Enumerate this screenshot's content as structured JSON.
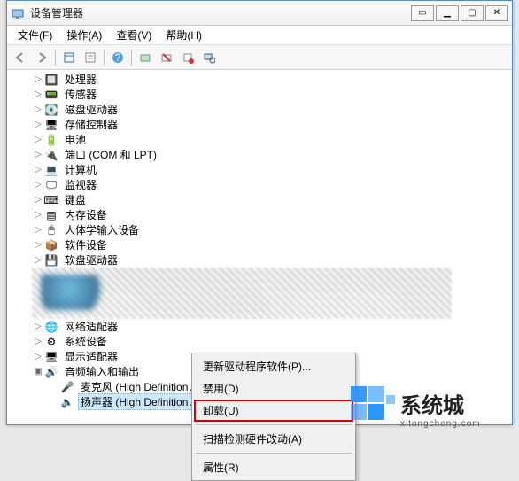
{
  "window": {
    "title": "设备管理器",
    "buttons": {
      "min": "▁",
      "max": "▢",
      "close": "✕",
      "extra": "▭"
    }
  },
  "menubar": {
    "file": "文件(F)",
    "action": "操作(A)",
    "view": "查看(V)",
    "help": "帮助(H)"
  },
  "tree": {
    "items": [
      {
        "label": "处理器",
        "icon": "cpu"
      },
      {
        "label": "传感器",
        "icon": "sensor"
      },
      {
        "label": "磁盘驱动器",
        "icon": "disk"
      },
      {
        "label": "存储控制器",
        "icon": "storage"
      },
      {
        "label": "电池",
        "icon": "battery"
      },
      {
        "label": "端口 (COM 和 LPT)",
        "icon": "port"
      },
      {
        "label": "计算机",
        "icon": "computer"
      },
      {
        "label": "监视器",
        "icon": "monitor"
      },
      {
        "label": "键盘",
        "icon": "keyboard"
      },
      {
        "label": "内存设备",
        "icon": "memory"
      },
      {
        "label": "人体学输入设备",
        "icon": "hid"
      },
      {
        "label": "软件设备",
        "icon": "software"
      },
      {
        "label": "软盘驱动器",
        "icon": "floppy"
      }
    ],
    "blurred_label": "（已隐藏条目）",
    "after": [
      {
        "label": "网络适配器",
        "icon": "network"
      },
      {
        "label": "系统设备",
        "icon": "system"
      },
      {
        "label": "显示适配器",
        "icon": "display"
      }
    ],
    "audio": {
      "label": "音频输入和输出",
      "children": [
        {
          "label": "麦克风 (High Definition Audio 设备)"
        },
        {
          "label": "扬声器 (High Definition Audio 设备)",
          "selected": true
        }
      ]
    }
  },
  "context_menu": {
    "update": "更新驱动程序软件(P)...",
    "disable": "禁用(D)",
    "uninstall": "卸载(U)",
    "scan": "扫描检测硬件改动(A)",
    "properties": "属性(R)"
  },
  "watermark": {
    "title": "系统城",
    "url": "xitongcheng.com"
  }
}
